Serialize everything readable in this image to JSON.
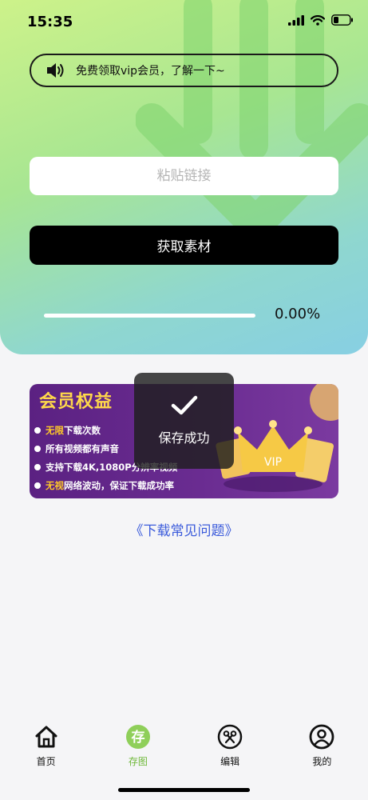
{
  "status_bar": {
    "time": "15:35",
    "icons": [
      "signal-icon",
      "wifi-icon",
      "battery-icon"
    ]
  },
  "banner": {
    "text": "免费领取vip会员，了解一下~",
    "icon": "speaker-icon"
  },
  "link_input": {
    "placeholder": "粘贴链接",
    "value": ""
  },
  "fetch_button": {
    "label": "获取素材"
  },
  "progress": {
    "value": 0.0,
    "text": "0.00%"
  },
  "vip_card": {
    "title": "会员权益",
    "benefits": [
      {
        "highlight": "无限",
        "rest": "下载次数"
      },
      {
        "highlight": "",
        "rest": "所有视频都有声音"
      },
      {
        "highlight": "",
        "rest": "支持下载4K,1080P分辨率视频"
      },
      {
        "highlight": "无视",
        "rest": "网络波动，保证下载成功率"
      }
    ],
    "badge": "VIP"
  },
  "toast": {
    "text": "保存成功",
    "icon": "checkmark-icon"
  },
  "faq_link": {
    "label": "《下载常见问题》"
  },
  "tabs": [
    {
      "label": "首页",
      "icon": "home-icon",
      "active": false
    },
    {
      "label": "存图",
      "icon": "save-icon",
      "active": true
    },
    {
      "label": "编辑",
      "icon": "scissors-icon",
      "active": false
    },
    {
      "label": "我的",
      "icon": "profile-icon",
      "active": false
    }
  ],
  "colors": {
    "accent_green": "#6fb83a",
    "link_blue": "#3b5bdb",
    "vip_purple": "#5b2182",
    "vip_gold": "#ffd84a"
  }
}
